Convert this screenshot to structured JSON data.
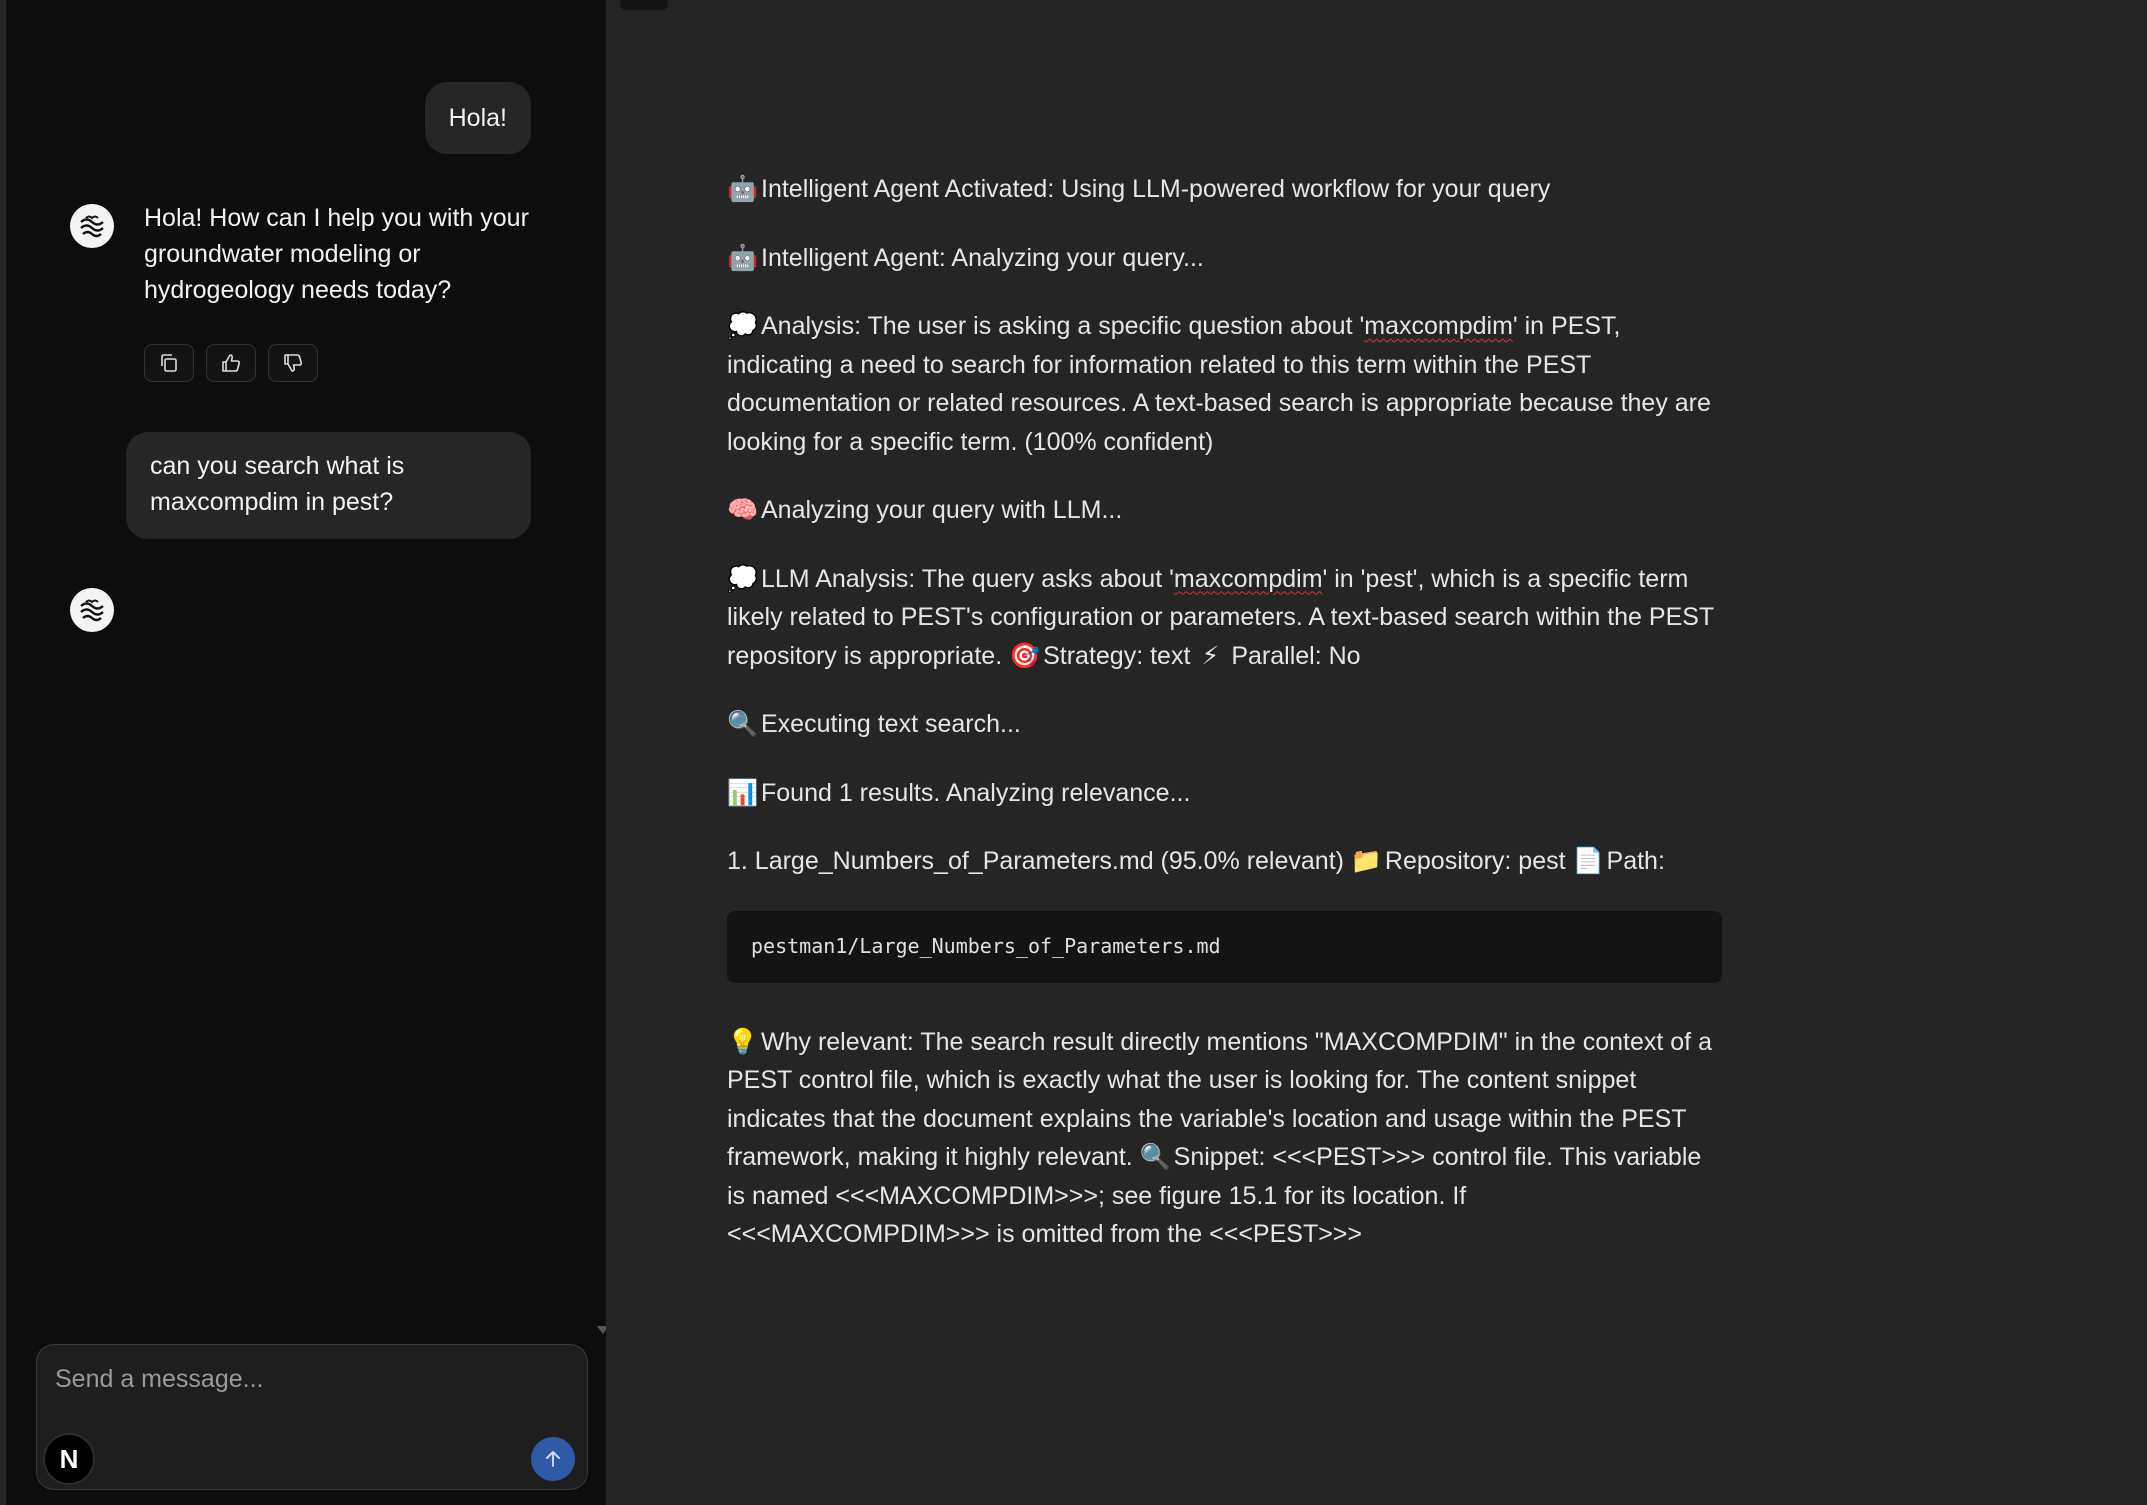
{
  "chat": {
    "messages": [
      {
        "role": "user",
        "text": "Hola!"
      },
      {
        "role": "assistant",
        "text": "Hola! How can I help you with your groundwater modeling or hydrogeology needs today?"
      },
      {
        "role": "user",
        "text": "can you search what is maxcompdim in pest?"
      }
    ],
    "actions": {
      "copy_icon": "copy-icon",
      "thumbs_up_icon": "thumbs-up-icon",
      "thumbs_down_icon": "thumbs-down-icon"
    },
    "composer": {
      "placeholder": "Send a message...",
      "badge_letter": "N",
      "send_icon": "arrow-up-icon"
    }
  },
  "document": {
    "lines": [
      {
        "emoji": "🤖",
        "text": "Intelligent Agent Activated: Using LLM-powered workflow for your query"
      },
      {
        "emoji": "🤖",
        "text": "Intelligent Agent: Analyzing your query..."
      },
      {
        "emoji": "💭",
        "pre": "Analysis: The user is asking a specific question about '",
        "term": "maxcompdim",
        "post": "' in PEST, indicating a need to search for information related to this term within the PEST documentation or related resources. A text-based search is appropriate because they are looking for a specific term. (100% confident)"
      },
      {
        "emoji": "🧠",
        "text": "Analyzing your query with LLM..."
      },
      {
        "emoji": "💭",
        "pre": "LLM Analysis: The query asks about '",
        "term": "maxcompdim",
        "post": "' in 'pest', which is a specific term likely related to PEST's configuration or parameters. A text-based search within the PEST repository is appropriate. ",
        "strategy_emoji": "🎯",
        "strategy": "Strategy: text",
        "parallel_emoji": "⚡",
        "parallel": "Parallel: No"
      },
      {
        "emoji": "🔍",
        "text": "Executing text search..."
      },
      {
        "emoji": "📊",
        "text": "Found 1 results. Analyzing relevance..."
      },
      {
        "result": "1. Large_Numbers_of_Parameters.md (95.0% relevant) ",
        "repo_emoji": "📁",
        "repo": "Repository: pest ",
        "path_emoji": "📄",
        "path": "Path:"
      }
    ],
    "code_path": "pestman1/Large_Numbers_of_Parameters.md",
    "relevance": {
      "emoji": "💡",
      "text": "Why relevant: The search result directly mentions \"MAXCOMPDIM\" in the context of a PEST control file, which is exactly what the user is looking for. The content snippet indicates that the document explains the variable's location and usage within the PEST framework, making it highly relevant. ",
      "snippet_emoji": "🔍",
      "snippet": "Snippet: <<<PEST>>> control file. This variable is named <<<MAXCOMPDIM>>>; see figure 15.1 for its location. If <<<MAXCOMPDIM>>> is omitted from the <<<PEST>>>"
    }
  }
}
